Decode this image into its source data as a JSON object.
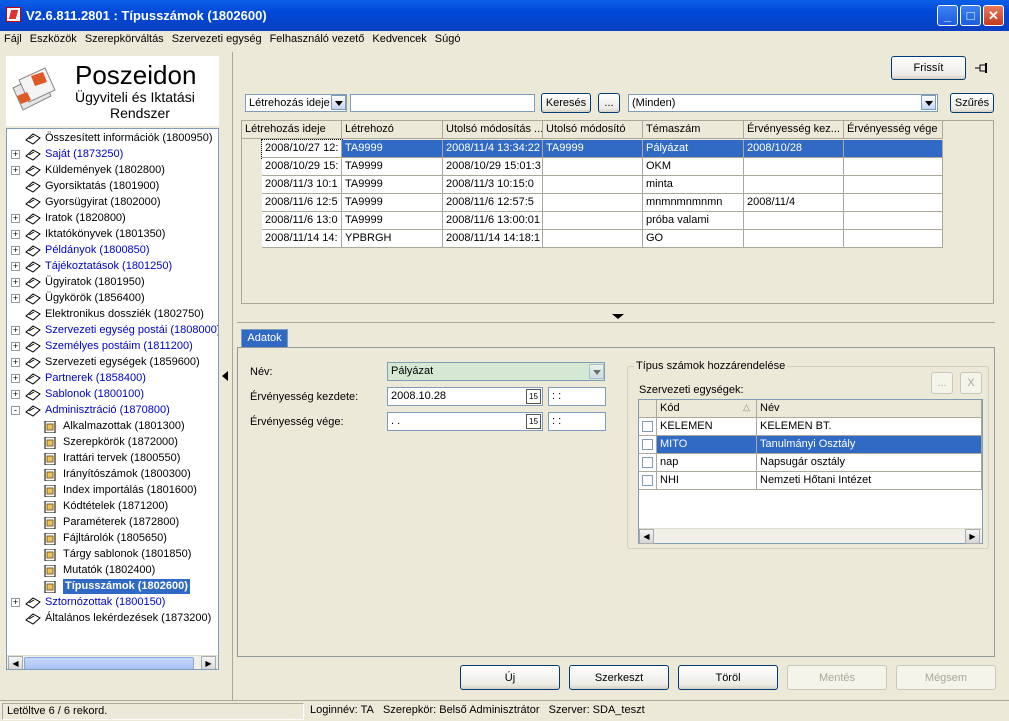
{
  "window": {
    "title": "V2.6.811.2801 : Típusszámok (1802600)"
  },
  "menu": [
    "Fájl",
    "Eszközök",
    "Szerepkörváltás",
    "Szervezeti egység",
    "Felhasználó vezető",
    "Kedvencek",
    "Súgó"
  ],
  "logo": {
    "title": "Poszeidon",
    "line1": "Ügyviteli és Iktatási",
    "line2": "Rendszer"
  },
  "tree": [
    {
      "label": "Összesített információk (1800950)",
      "level": 0,
      "expander": "",
      "color": "black"
    },
    {
      "label": "Saját (1873250)",
      "level": 0,
      "expander": "+",
      "color": "blue"
    },
    {
      "label": "Küldemények (1802800)",
      "level": 0,
      "expander": "+",
      "color": "black"
    },
    {
      "label": "Gyorsiktatás (1801900)",
      "level": 0,
      "expander": "",
      "color": "black"
    },
    {
      "label": "Gyorsügyirat (1802000)",
      "level": 0,
      "expander": "",
      "color": "black"
    },
    {
      "label": "Iratok (1820800)",
      "level": 0,
      "expander": "+",
      "color": "black"
    },
    {
      "label": "Iktatókönyvek (1801350)",
      "level": 0,
      "expander": "+",
      "color": "black"
    },
    {
      "label": "Példányok (1800850)",
      "level": 0,
      "expander": "+",
      "color": "blue"
    },
    {
      "label": "Tájékoztatások (1801250)",
      "level": 0,
      "expander": "+",
      "color": "blue"
    },
    {
      "label": "Ügyiratok (1801950)",
      "level": 0,
      "expander": "+",
      "color": "black"
    },
    {
      "label": "Ügykörök (1856400)",
      "level": 0,
      "expander": "+",
      "color": "black"
    },
    {
      "label": "Elektronikus dossziék (1802750)",
      "level": 0,
      "expander": "",
      "color": "black"
    },
    {
      "label": "Szervezeti egység postái (1808000)",
      "level": 0,
      "expander": "+",
      "color": "blue"
    },
    {
      "label": "Személyes postáim (1811200)",
      "level": 0,
      "expander": "+",
      "color": "blue"
    },
    {
      "label": "Szervezeti egységek (1859600)",
      "level": 0,
      "expander": "+",
      "color": "black"
    },
    {
      "label": "Partnerek (1858400)",
      "level": 0,
      "expander": "+",
      "color": "blue"
    },
    {
      "label": "Sablonok (1800100)",
      "level": 0,
      "expander": "+",
      "color": "blue"
    },
    {
      "label": "Adminisztráció (1870800)",
      "level": 0,
      "expander": "-",
      "color": "blue"
    },
    {
      "label": "Alkalmazottak (1801300)",
      "level": 1,
      "expander": "",
      "color": "black"
    },
    {
      "label": "Szerepkörök (1872000)",
      "level": 1,
      "expander": "",
      "color": "black"
    },
    {
      "label": "Irattári tervek (1800550)",
      "level": 1,
      "expander": "",
      "color": "black"
    },
    {
      "label": "Irányítószámok (1800300)",
      "level": 1,
      "expander": "",
      "color": "black"
    },
    {
      "label": "Index importálás (1801600)",
      "level": 1,
      "expander": "",
      "color": "black"
    },
    {
      "label": "Kódtételek (1871200)",
      "level": 1,
      "expander": "",
      "color": "black"
    },
    {
      "label": "Paraméterek (1872800)",
      "level": 1,
      "expander": "",
      "color": "black"
    },
    {
      "label": "Fájltárolók (1805650)",
      "level": 1,
      "expander": "",
      "color": "black"
    },
    {
      "label": "Tárgy sablonok (1801850)",
      "level": 1,
      "expander": "",
      "color": "black"
    },
    {
      "label": "Mutatók (1802400)",
      "level": 1,
      "expander": "",
      "color": "black"
    },
    {
      "label": "Típusszámok (1802600)",
      "level": 1,
      "expander": "",
      "color": "selected"
    },
    {
      "label": "Sztornózottak (1800150)",
      "level": 0,
      "expander": "+",
      "color": "blue"
    },
    {
      "label": "Általános lekérdezések (1873200)",
      "level": 0,
      "expander": "",
      "color": "black"
    }
  ],
  "toolbar": {
    "refresh": "Frissít",
    "search_field": "Létrehozás ideje",
    "search_button": "Keresés",
    "ellipsis": "...",
    "filter_value": "(Minden)",
    "filter_button": "Szűrés"
  },
  "grid": {
    "columns": [
      "Létrehozás ideje",
      "Létrehozó",
      "Utolsó módosítás ...",
      "Utolsó módosító",
      "Témaszám",
      "Érvényesség kez...",
      "Érvényesség vége"
    ],
    "rows": [
      [
        "2008/10/27 12:",
        "TA9999",
        "2008/11/4 13:34:22",
        "TA9999",
        "Pályázat",
        "2008/10/28",
        ""
      ],
      [
        "2008/10/29 15:",
        "TA9999",
        "2008/10/29 15:01:3",
        "",
        "OKM",
        "",
        ""
      ],
      [
        "2008/11/3 10:1",
        "TA9999",
        "2008/11/3 10:15:0",
        "",
        "minta",
        "",
        ""
      ],
      [
        "2008/11/6 12:5",
        "TA9999",
        "2008/11/6 12:57:5",
        "",
        "mnmnmnmnmn",
        "2008/11/4",
        ""
      ],
      [
        "2008/11/6 13:0",
        "TA9999",
        "2008/11/6 13:00:01",
        "",
        "próba valami",
        "",
        ""
      ],
      [
        "2008/11/14 14:",
        "YPBRGH",
        "2008/11/14 14:18:1",
        "",
        "GO",
        "",
        ""
      ]
    ]
  },
  "tab": "Adatok",
  "form": {
    "name_label": "Név:",
    "name_value": "Pályázat",
    "start_label": "Érvényesség kezdete:",
    "start_value": "2008.10.28",
    "start_time": " : :",
    "end_label": "Érvényesség vége:",
    "end_value": " .  .",
    "end_time": " : :",
    "cal_icon": "15"
  },
  "assign": {
    "group_title": "Típus számok hozzárendelése",
    "units_label": "Szervezeti egységek:",
    "add_button": "...",
    "remove_button": "X",
    "columns": [
      "Kód",
      "Név"
    ],
    "rows": [
      [
        "KELEMEN",
        "KELEMEN BT."
      ],
      [
        "MITO",
        "Tanulmányi Osztály"
      ],
      [
        "nap",
        "Napsugár osztály"
      ],
      [
        "NHI",
        "Nemzeti Hőtani Intézet"
      ]
    ]
  },
  "buttons": {
    "new": "Új",
    "edit": "Szerkeszt",
    "delete": "Töröl",
    "save": "Mentés",
    "cancel": "Mégsem"
  },
  "status": {
    "records": "Letöltve 6 / 6 rekord.",
    "login": "Loginnév: TA",
    "role": "Szerepkör: Belső Adminisztrátor",
    "server": "Szerver: SDA_teszt"
  }
}
